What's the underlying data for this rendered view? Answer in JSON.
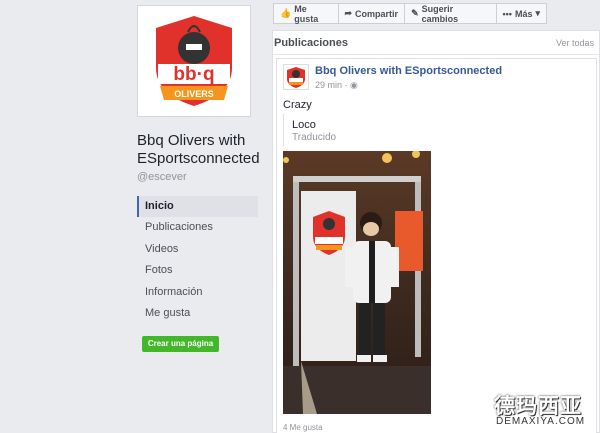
{
  "page": {
    "name": "Bbq Olivers with ESportsconnected",
    "handle": "@escever",
    "logo_text": "bb·q",
    "logo_banner": "OLIVERS"
  },
  "sidebar": {
    "items": [
      {
        "label": "Inicio",
        "active": true
      },
      {
        "label": "Publicaciones",
        "active": false
      },
      {
        "label": "Videos",
        "active": false
      },
      {
        "label": "Fotos",
        "active": false
      },
      {
        "label": "Información",
        "active": false
      },
      {
        "label": "Me gusta",
        "active": false
      }
    ],
    "create_button": "Crear una página"
  },
  "toolbar": {
    "like": "Me gusta",
    "share": "Compartir",
    "suggest": "Sugerir cambios",
    "more": "Más"
  },
  "feed": {
    "header": "Publicaciones",
    "see_all": "Ver todas",
    "post": {
      "author": "Bbq Olivers with ESportsconnected",
      "time": "29 min · ",
      "text": "Crazy",
      "translation": "Loco",
      "translated_label": "Traducido",
      "likes": "4 Me gusta"
    }
  },
  "watermark": {
    "chinese": "德玛西亚",
    "latin": "DEMAXIYA.COM"
  },
  "colors": {
    "brand_blue": "#365899",
    "green_button": "#42b72a",
    "logo_red": "#e0312b",
    "logo_orange": "#f7941d"
  }
}
